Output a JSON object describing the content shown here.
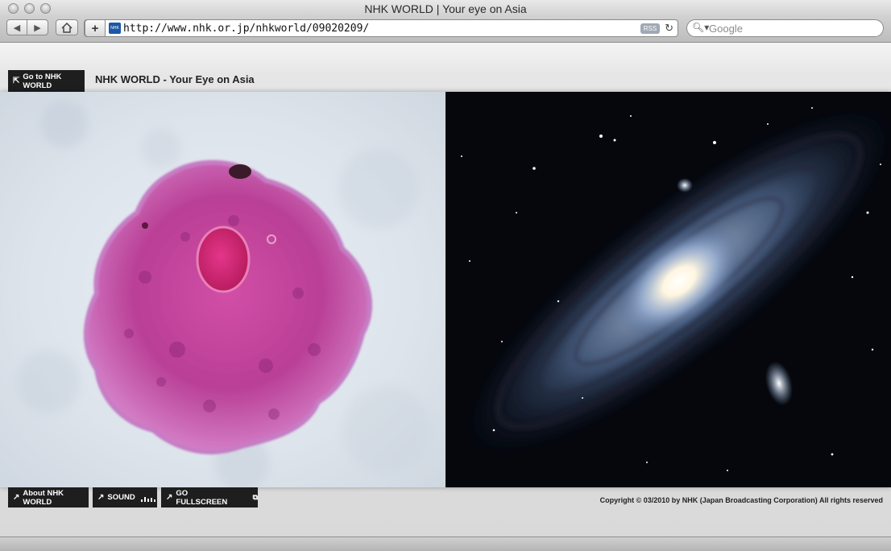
{
  "window": {
    "title": "NHK WORLD | Your eye on Asia"
  },
  "toolbar": {
    "back_icon": "back-arrow-icon",
    "forward_icon": "forward-arrow-icon",
    "home_icon": "home-icon",
    "add_icon": "plus-icon",
    "url": "http://www.nhk.or.jp/nhkworld/09020209/",
    "favicon_text": "NHK",
    "rss_label": "RSS",
    "search_placeholder": "Google"
  },
  "page": {
    "goto_label": "Go to NHK WORLD",
    "site_title": "NHK WORLD - Your Eye on Asia",
    "about_label": "About NHK WORLD",
    "sound_label": "SOUND",
    "fullscreen_label": "GO FULLSCREEN",
    "copyright": "Copyright © 03/2010 by NHK (Japan Broadcasting Corporation) All rights reserved"
  },
  "colors": {
    "cell_pink": "#c2449a",
    "nucleus": "#d0266e",
    "space_bg": "#05070d",
    "galaxy_blue": "#7fa6d8"
  }
}
